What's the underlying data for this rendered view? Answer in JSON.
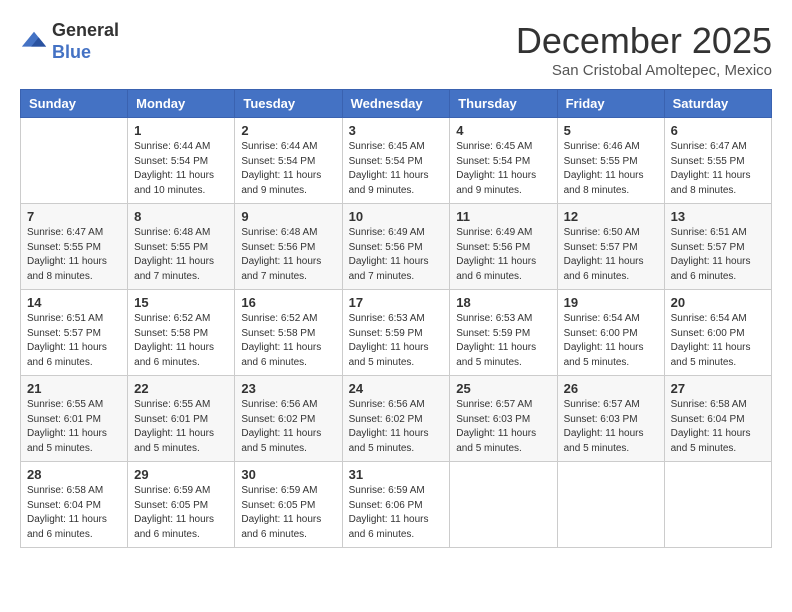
{
  "logo": {
    "general": "General",
    "blue": "Blue"
  },
  "header": {
    "month": "December 2025",
    "location": "San Cristobal Amoltepec, Mexico"
  },
  "days_of_week": [
    "Sunday",
    "Monday",
    "Tuesday",
    "Wednesday",
    "Thursday",
    "Friday",
    "Saturday"
  ],
  "weeks": [
    [
      {
        "day": "",
        "sunrise": "",
        "sunset": "",
        "daylight": ""
      },
      {
        "day": "1",
        "sunrise": "Sunrise: 6:44 AM",
        "sunset": "Sunset: 5:54 PM",
        "daylight": "Daylight: 11 hours and 10 minutes."
      },
      {
        "day": "2",
        "sunrise": "Sunrise: 6:44 AM",
        "sunset": "Sunset: 5:54 PM",
        "daylight": "Daylight: 11 hours and 9 minutes."
      },
      {
        "day": "3",
        "sunrise": "Sunrise: 6:45 AM",
        "sunset": "Sunset: 5:54 PM",
        "daylight": "Daylight: 11 hours and 9 minutes."
      },
      {
        "day": "4",
        "sunrise": "Sunrise: 6:45 AM",
        "sunset": "Sunset: 5:54 PM",
        "daylight": "Daylight: 11 hours and 9 minutes."
      },
      {
        "day": "5",
        "sunrise": "Sunrise: 6:46 AM",
        "sunset": "Sunset: 5:55 PM",
        "daylight": "Daylight: 11 hours and 8 minutes."
      },
      {
        "day": "6",
        "sunrise": "Sunrise: 6:47 AM",
        "sunset": "Sunset: 5:55 PM",
        "daylight": "Daylight: 11 hours and 8 minutes."
      }
    ],
    [
      {
        "day": "7",
        "sunrise": "Sunrise: 6:47 AM",
        "sunset": "Sunset: 5:55 PM",
        "daylight": "Daylight: 11 hours and 8 minutes."
      },
      {
        "day": "8",
        "sunrise": "Sunrise: 6:48 AM",
        "sunset": "Sunset: 5:55 PM",
        "daylight": "Daylight: 11 hours and 7 minutes."
      },
      {
        "day": "9",
        "sunrise": "Sunrise: 6:48 AM",
        "sunset": "Sunset: 5:56 PM",
        "daylight": "Daylight: 11 hours and 7 minutes."
      },
      {
        "day": "10",
        "sunrise": "Sunrise: 6:49 AM",
        "sunset": "Sunset: 5:56 PM",
        "daylight": "Daylight: 11 hours and 7 minutes."
      },
      {
        "day": "11",
        "sunrise": "Sunrise: 6:49 AM",
        "sunset": "Sunset: 5:56 PM",
        "daylight": "Daylight: 11 hours and 6 minutes."
      },
      {
        "day": "12",
        "sunrise": "Sunrise: 6:50 AM",
        "sunset": "Sunset: 5:57 PM",
        "daylight": "Daylight: 11 hours and 6 minutes."
      },
      {
        "day": "13",
        "sunrise": "Sunrise: 6:51 AM",
        "sunset": "Sunset: 5:57 PM",
        "daylight": "Daylight: 11 hours and 6 minutes."
      }
    ],
    [
      {
        "day": "14",
        "sunrise": "Sunrise: 6:51 AM",
        "sunset": "Sunset: 5:57 PM",
        "daylight": "Daylight: 11 hours and 6 minutes."
      },
      {
        "day": "15",
        "sunrise": "Sunrise: 6:52 AM",
        "sunset": "Sunset: 5:58 PM",
        "daylight": "Daylight: 11 hours and 6 minutes."
      },
      {
        "day": "16",
        "sunrise": "Sunrise: 6:52 AM",
        "sunset": "Sunset: 5:58 PM",
        "daylight": "Daylight: 11 hours and 6 minutes."
      },
      {
        "day": "17",
        "sunrise": "Sunrise: 6:53 AM",
        "sunset": "Sunset: 5:59 PM",
        "daylight": "Daylight: 11 hours and 5 minutes."
      },
      {
        "day": "18",
        "sunrise": "Sunrise: 6:53 AM",
        "sunset": "Sunset: 5:59 PM",
        "daylight": "Daylight: 11 hours and 5 minutes."
      },
      {
        "day": "19",
        "sunrise": "Sunrise: 6:54 AM",
        "sunset": "Sunset: 6:00 PM",
        "daylight": "Daylight: 11 hours and 5 minutes."
      },
      {
        "day": "20",
        "sunrise": "Sunrise: 6:54 AM",
        "sunset": "Sunset: 6:00 PM",
        "daylight": "Daylight: 11 hours and 5 minutes."
      }
    ],
    [
      {
        "day": "21",
        "sunrise": "Sunrise: 6:55 AM",
        "sunset": "Sunset: 6:01 PM",
        "daylight": "Daylight: 11 hours and 5 minutes."
      },
      {
        "day": "22",
        "sunrise": "Sunrise: 6:55 AM",
        "sunset": "Sunset: 6:01 PM",
        "daylight": "Daylight: 11 hours and 5 minutes."
      },
      {
        "day": "23",
        "sunrise": "Sunrise: 6:56 AM",
        "sunset": "Sunset: 6:02 PM",
        "daylight": "Daylight: 11 hours and 5 minutes."
      },
      {
        "day": "24",
        "sunrise": "Sunrise: 6:56 AM",
        "sunset": "Sunset: 6:02 PM",
        "daylight": "Daylight: 11 hours and 5 minutes."
      },
      {
        "day": "25",
        "sunrise": "Sunrise: 6:57 AM",
        "sunset": "Sunset: 6:03 PM",
        "daylight": "Daylight: 11 hours and 5 minutes."
      },
      {
        "day": "26",
        "sunrise": "Sunrise: 6:57 AM",
        "sunset": "Sunset: 6:03 PM",
        "daylight": "Daylight: 11 hours and 5 minutes."
      },
      {
        "day": "27",
        "sunrise": "Sunrise: 6:58 AM",
        "sunset": "Sunset: 6:04 PM",
        "daylight": "Daylight: 11 hours and 5 minutes."
      }
    ],
    [
      {
        "day": "28",
        "sunrise": "Sunrise: 6:58 AM",
        "sunset": "Sunset: 6:04 PM",
        "daylight": "Daylight: 11 hours and 6 minutes."
      },
      {
        "day": "29",
        "sunrise": "Sunrise: 6:59 AM",
        "sunset": "Sunset: 6:05 PM",
        "daylight": "Daylight: 11 hours and 6 minutes."
      },
      {
        "day": "30",
        "sunrise": "Sunrise: 6:59 AM",
        "sunset": "Sunset: 6:05 PM",
        "daylight": "Daylight: 11 hours and 6 minutes."
      },
      {
        "day": "31",
        "sunrise": "Sunrise: 6:59 AM",
        "sunset": "Sunset: 6:06 PM",
        "daylight": "Daylight: 11 hours and 6 minutes."
      },
      {
        "day": "",
        "sunrise": "",
        "sunset": "",
        "daylight": ""
      },
      {
        "day": "",
        "sunrise": "",
        "sunset": "",
        "daylight": ""
      },
      {
        "day": "",
        "sunrise": "",
        "sunset": "",
        "daylight": ""
      }
    ]
  ]
}
